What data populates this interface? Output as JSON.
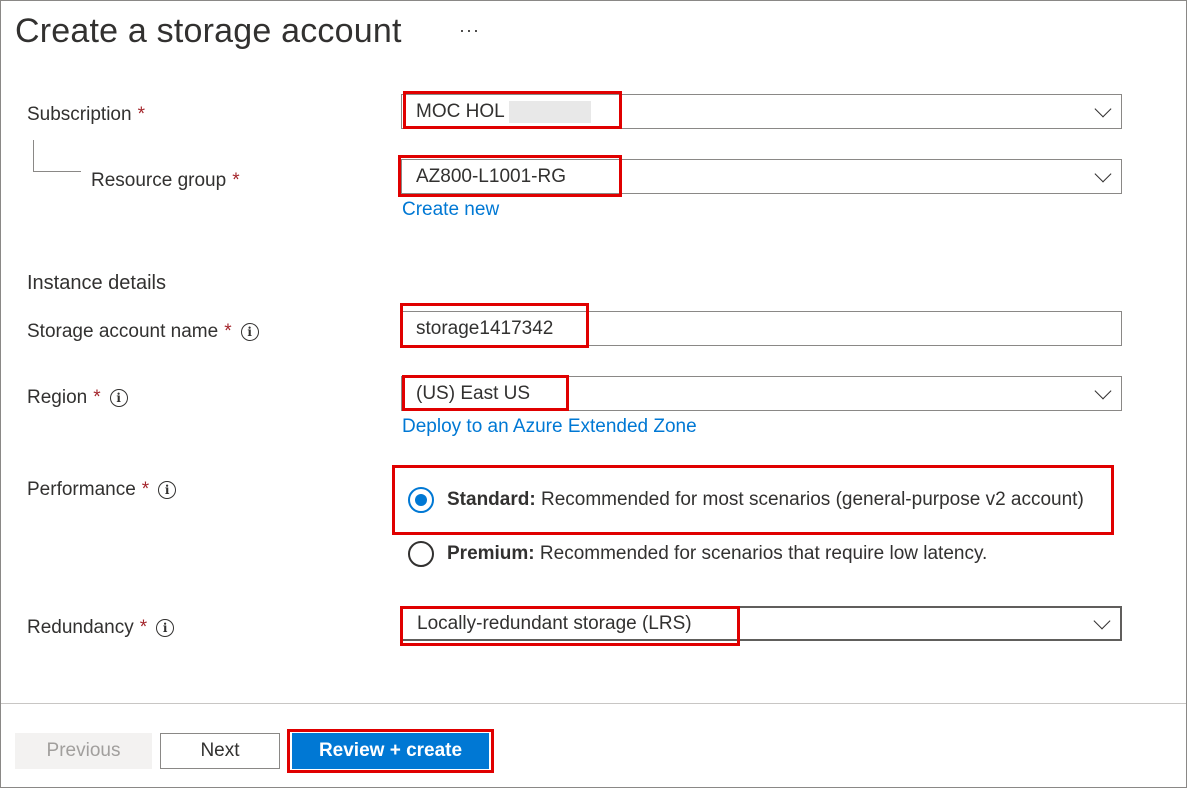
{
  "header": {
    "title": "Create a storage account",
    "more_label": "···"
  },
  "form": {
    "subscription": {
      "label": "Subscription",
      "required_mark": "*",
      "value": "MOC HOL"
    },
    "resource_group": {
      "label": "Resource group",
      "required_mark": "*",
      "value": "AZ800-L1001-RG",
      "create_new_link": "Create new"
    },
    "instance_details_heading": "Instance details",
    "storage_account_name": {
      "label": "Storage account name",
      "required_mark": "*",
      "info_icon": "i",
      "value": "storage1417342"
    },
    "region": {
      "label": "Region",
      "required_mark": "*",
      "info_icon": "i",
      "value": "(US) East US",
      "extended_zone_link": "Deploy to an Azure Extended Zone"
    },
    "performance": {
      "label": "Performance",
      "required_mark": "*",
      "info_icon": "i",
      "options": [
        {
          "name": "Standard:",
          "description": " Recommended for most scenarios (general-purpose v2 account)",
          "selected": true
        },
        {
          "name": "Premium:",
          "description": " Recommended for scenarios that require low latency.",
          "selected": false
        }
      ]
    },
    "redundancy": {
      "label": "Redundancy",
      "required_mark": "*",
      "info_icon": "i",
      "value": "Locally-redundant storage (LRS)"
    }
  },
  "footer": {
    "previous_label": "Previous",
    "next_label": "Next",
    "review_create_label": "Review + create"
  },
  "colors": {
    "accent": "#0078d4",
    "required": "#a4262c",
    "highlight_box": "#e00000"
  }
}
